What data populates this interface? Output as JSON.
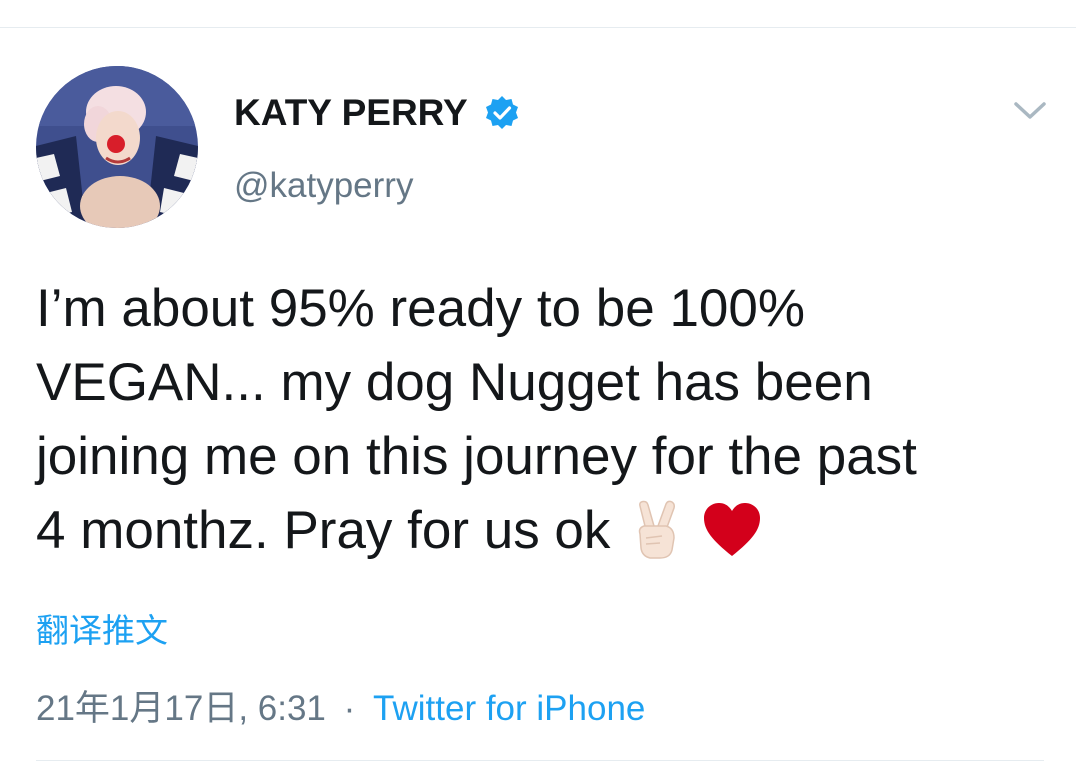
{
  "user": {
    "display_name": "KATY PERRY",
    "handle": "@katyperry",
    "verified": true
  },
  "tweet": {
    "lines": [
      "I’m about 95% ready to be 100%",
      "VEGAN... my dog Nugget has been",
      "joining me on this journey for the past",
      "4 monthz. Pray for us ok"
    ],
    "emojis": [
      "victory-hand-emoji",
      "red-heart-emoji"
    ]
  },
  "translate_label": "翻译推文",
  "meta": {
    "timestamp": "21年1月17日, 6:31",
    "separator": "·",
    "source": "Twitter for iPhone"
  },
  "colors": {
    "text": "#14171a",
    "secondary": "#657786",
    "link": "#1da1f2",
    "verified": "#1da1f2",
    "heart": "#d3001b"
  },
  "icons": {
    "verified": "verified-badge-icon",
    "menu": "chevron-down-icon"
  }
}
